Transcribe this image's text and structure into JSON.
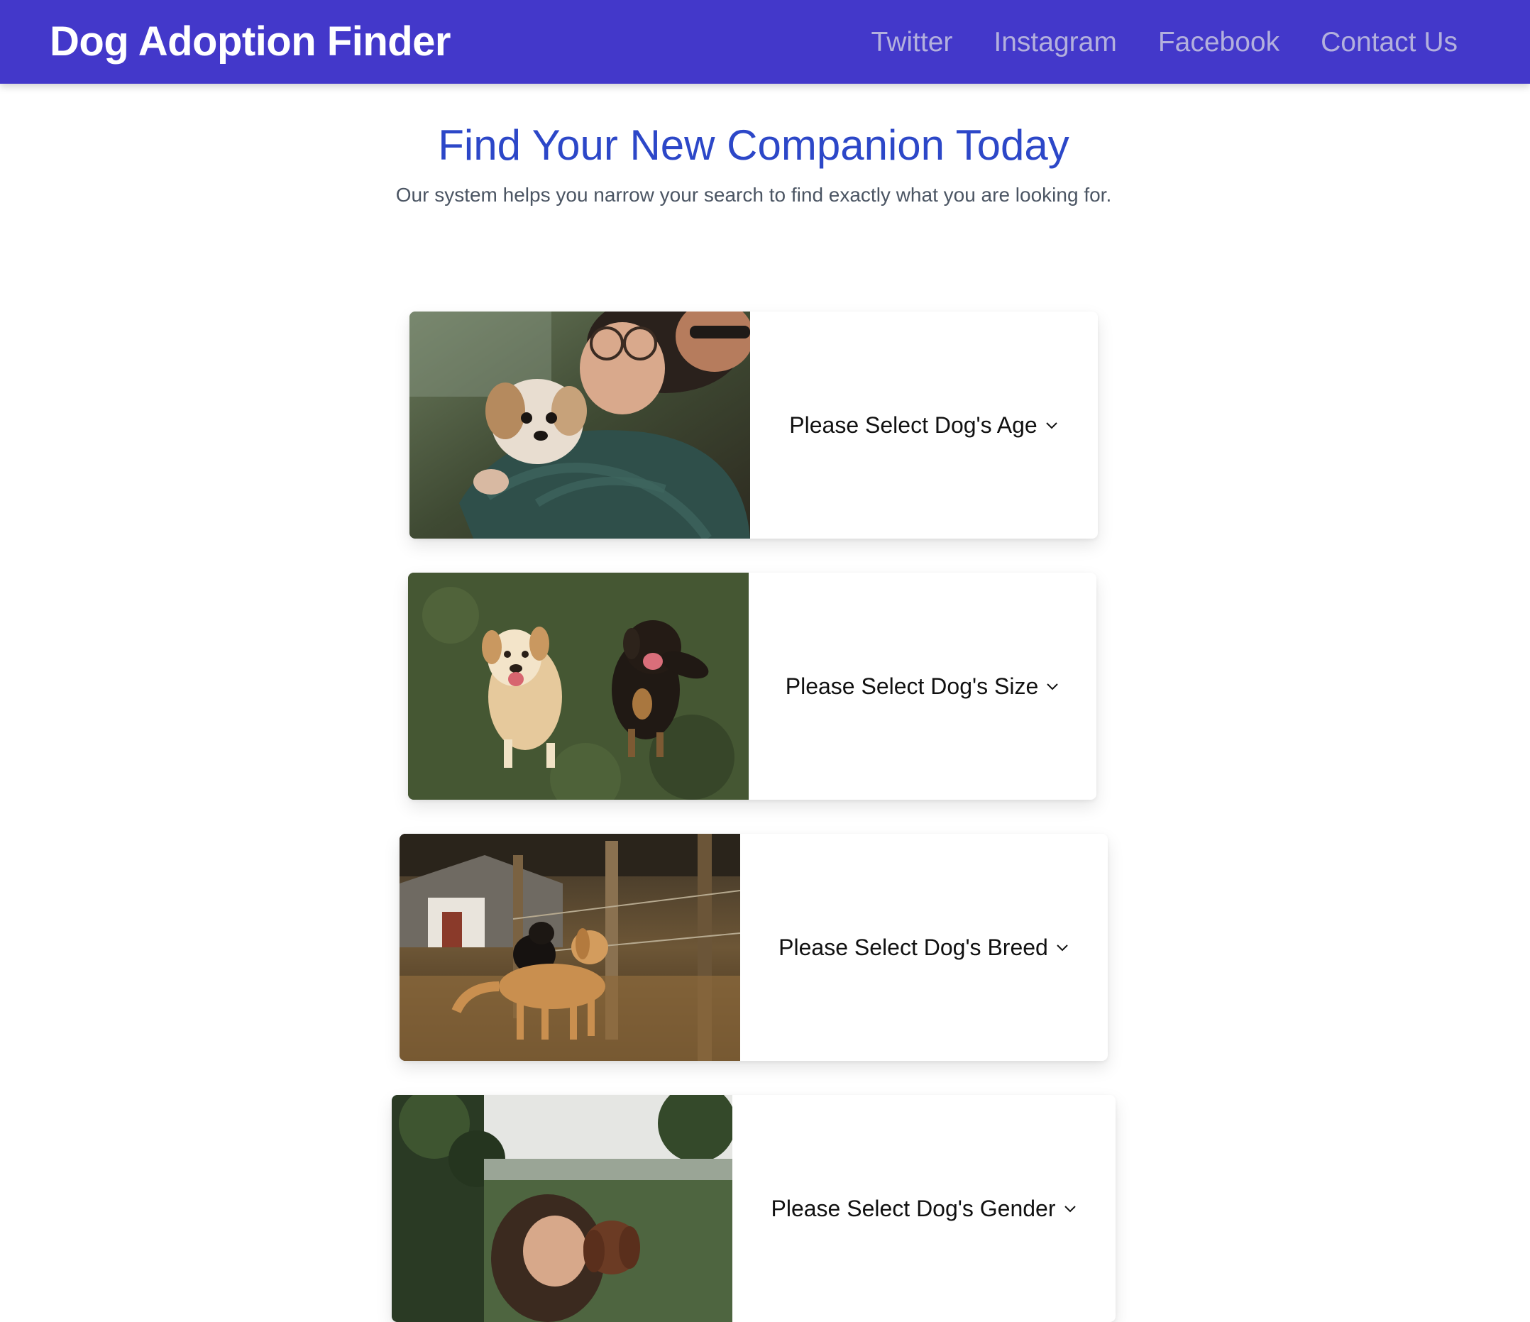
{
  "header": {
    "brand": "Dog Adoption Finder",
    "links": [
      "Twitter",
      "Instagram",
      "Facebook",
      "Contact Us"
    ]
  },
  "hero": {
    "title": "Find Your New Companion Today",
    "subtitle": "Our system helps you narrow your search to find exactly what you are looking for."
  },
  "filters": [
    {
      "label": "Please Select Dog's Age",
      "photo": "person-hugging-small-dog"
    },
    {
      "label": "Please Select Dog's Size",
      "photo": "two-dogs-on-grass"
    },
    {
      "label": "Please Select Dog's Breed",
      "photo": "two-dogs-by-fence"
    },
    {
      "label": "Please Select Dog's Gender",
      "photo": "woman-with-dog"
    }
  ],
  "colors": {
    "navbar": "#4338ca",
    "brand_text": "#ffffff",
    "nav_link": "#b3b0dd",
    "title": "#2c47c8",
    "subtitle": "#4b5563"
  }
}
